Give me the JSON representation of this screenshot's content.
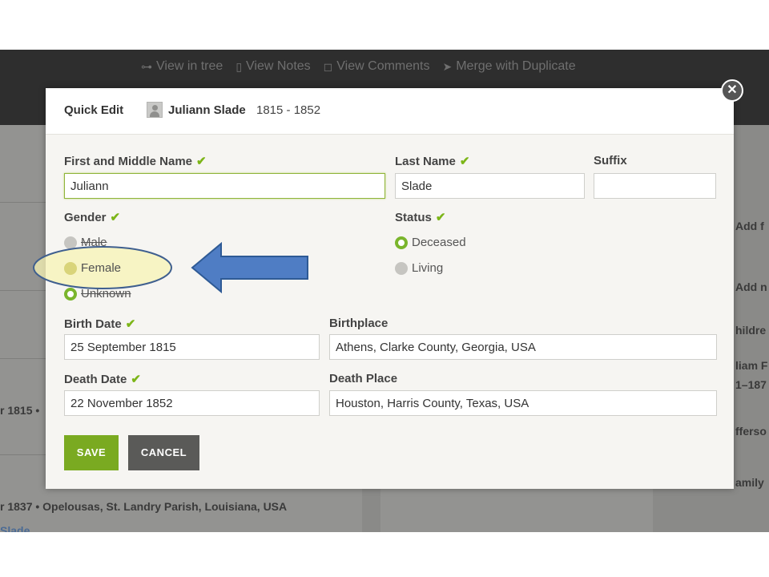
{
  "background": {
    "links": [
      {
        "icon": "tree-icon",
        "glyph": "⊶",
        "label": "View in tree"
      },
      {
        "icon": "notes-icon",
        "glyph": "▯",
        "label": "View Notes"
      },
      {
        "icon": "comments-icon",
        "glyph": "◻",
        "label": "View Comments"
      },
      {
        "icon": "merge-icon",
        "glyph": "➤",
        "label": "Merge with Duplicate"
      }
    ],
    "left_fragments": [
      "r 1815 •",
      "r 1837 • Opelousas, St. Landry Parish, Louisiana, USA",
      "Slade"
    ],
    "right_fragments": [
      "Add f",
      "Add n",
      "hildre",
      "liam F",
      "1–187",
      "fferso",
      "amily"
    ]
  },
  "modal": {
    "title": "Quick Edit",
    "person_name": "Juliann Slade",
    "person_dates": "1815 - 1852",
    "close_glyph": "✕",
    "check_glyph": "✔",
    "first_name": {
      "label": "First and Middle Name",
      "value": "Juliann"
    },
    "last_name": {
      "label": "Last Name",
      "value": "Slade"
    },
    "suffix": {
      "label": "Suffix",
      "value": ""
    },
    "gender": {
      "label": "Gender",
      "options": [
        "Male",
        "Female",
        "Unknown"
      ],
      "selected": "Unknown"
    },
    "status": {
      "label": "Status",
      "options": [
        "Deceased",
        "Living"
      ],
      "selected": "Deceased"
    },
    "birth_date": {
      "label": "Birth Date",
      "value": "25 September 1815"
    },
    "birthplace": {
      "label": "Birthplace",
      "value": "Athens, Clarke County, Georgia, USA"
    },
    "death_date": {
      "label": "Death Date",
      "value": "22 November 1852"
    },
    "death_place": {
      "label": "Death Place",
      "value": "Houston, Harris County, Texas, USA"
    },
    "save_label": "SAVE",
    "cancel_label": "CANCEL"
  },
  "colors": {
    "accent_green": "#7aaa21",
    "annotation_highlight": "#f7f3b4",
    "annotation_arrow": "#4f7dc4"
  }
}
